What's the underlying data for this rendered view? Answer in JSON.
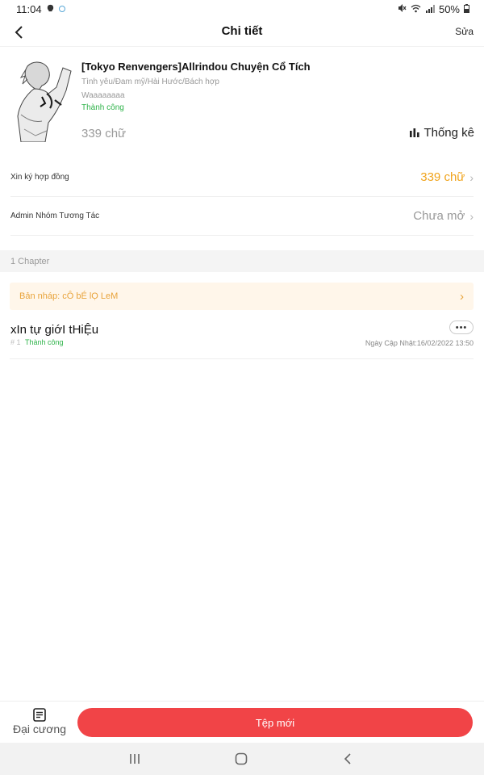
{
  "status_bar": {
    "time": "11:04",
    "battery": "50%"
  },
  "header": {
    "title": "Chi tiết",
    "edit_label": "Sửa"
  },
  "book": {
    "title": "[Tokyo Renvengers]Allrindou Chuyện Cổ Tích",
    "genres": "Tình yêu/Đam mỹ/Hài Hước/Bách hợp",
    "description": "Waaaaaaaa",
    "status": "Thành công",
    "word_count": "339 chữ",
    "stats_label": "Thống kê"
  },
  "rows": [
    {
      "label": "Xin ký hợp đồng",
      "value": "339 chữ",
      "value_color": "#f0a31b"
    },
    {
      "label": "Admin Nhóm Tương Tác",
      "value": "Chưa mở",
      "value_color": "#999999"
    }
  ],
  "chapters_section": {
    "count_label": "1 Chapter"
  },
  "draft": {
    "label": "Bản nháp: cÔ bÉ lỌ LeM"
  },
  "chapters": [
    {
      "title": "xIn tự giớI tHiỆu",
      "number": "# 1",
      "status": "Thành công",
      "updated": "Ngày Cập Nhật:16/02/2022 13:50",
      "more": "•••"
    }
  ],
  "bottom_bar": {
    "outline_label": "Đại cương",
    "new_file_label": "Tệp mới"
  },
  "colors": {
    "accent": "#f14447",
    "success": "#2fb34a",
    "warning": "#e8a33a"
  }
}
